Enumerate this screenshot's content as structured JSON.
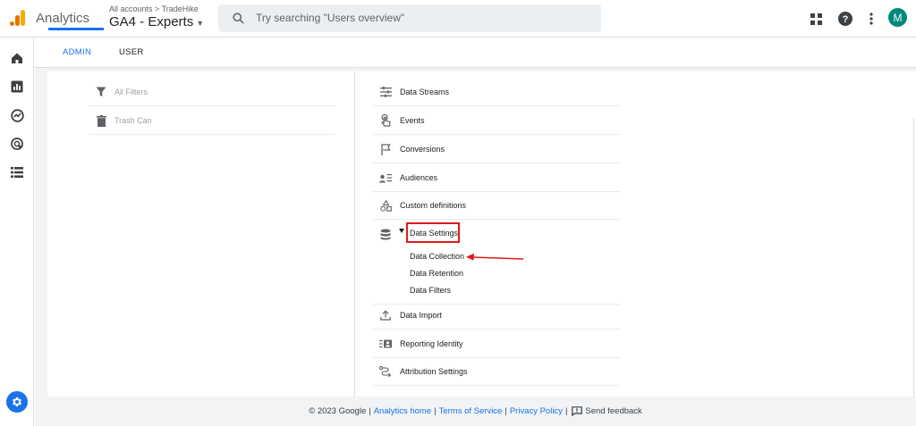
{
  "header": {
    "app_name": "Analytics",
    "account_breadcrumb": "All accounts > TradeHike",
    "property_name": "GA4 - Experts",
    "search_placeholder": "Try searching \"Users overview\"",
    "avatar_letter": "M",
    "icons": [
      "apps-grid-icon",
      "help-icon",
      "more-vert-icon"
    ]
  },
  "tabs": [
    {
      "label": "ADMIN",
      "active": true
    },
    {
      "label": "USER",
      "active": false
    }
  ],
  "left_column": {
    "items": [
      {
        "label": "All Filters",
        "icon": "filter-icon"
      },
      {
        "label": "Trash Can",
        "icon": "trash-icon"
      }
    ]
  },
  "right_column": {
    "items": [
      {
        "label": "Data Streams",
        "icon": "data-streams-icon"
      },
      {
        "label": "Events",
        "icon": "touch-icon"
      },
      {
        "label": "Conversions",
        "icon": "flag-icon"
      },
      {
        "label": "Audiences",
        "icon": "audiences-icon"
      },
      {
        "label": "Custom definitions",
        "icon": "shapes-icon"
      },
      {
        "label": "Data Settings",
        "icon": "database-icon",
        "expanded": true
      },
      {
        "label": "Data Import",
        "icon": "upload-icon"
      },
      {
        "label": "Reporting Identity",
        "icon": "reporting-identity-icon"
      },
      {
        "label": "Attribution Settings",
        "icon": "attribution-icon"
      }
    ],
    "data_settings_children": [
      "Data Collection",
      "Data Retention",
      "Data Filters"
    ]
  },
  "annotation": {
    "highlight_color": "#e0191b"
  },
  "footer": {
    "copyright": "© 2023 Google",
    "links": [
      "Analytics home",
      "Terms of Service",
      "Privacy Policy"
    ],
    "feedback": "Send feedback"
  },
  "colors": {
    "accent": "#1a73e8",
    "avatar_bg": "#00897b",
    "logo_orange": "#f9ab00",
    "logo_dark": "#e37400"
  }
}
